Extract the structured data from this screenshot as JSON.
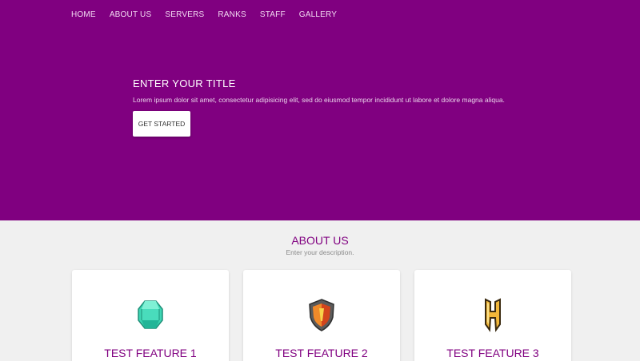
{
  "nav": {
    "items": [
      "HOME",
      "ABOUT US",
      "SERVERS",
      "RANKS",
      "STAFF",
      "GALLERY"
    ]
  },
  "hero": {
    "title": "ENTER YOUR TITLE",
    "text": "Lorem ipsum dolor sit amet, consectetur adipisicing elit, sed do eiusmod tempor incididunt ut labore et dolore magna aliqua.",
    "cta_label": "GET STARTED"
  },
  "about": {
    "title": "ABOUT US",
    "subtitle": "Enter your description."
  },
  "features": [
    {
      "title": "TEST FEATURE 1",
      "icon": "emerald-gem-icon"
    },
    {
      "title": "TEST FEATURE 2",
      "icon": "shield-icon"
    },
    {
      "title": "TEST FEATURE 3",
      "icon": "h-logo-icon"
    }
  ],
  "colors": {
    "brand": "#800080",
    "page_bg": "#f0f0f0"
  }
}
